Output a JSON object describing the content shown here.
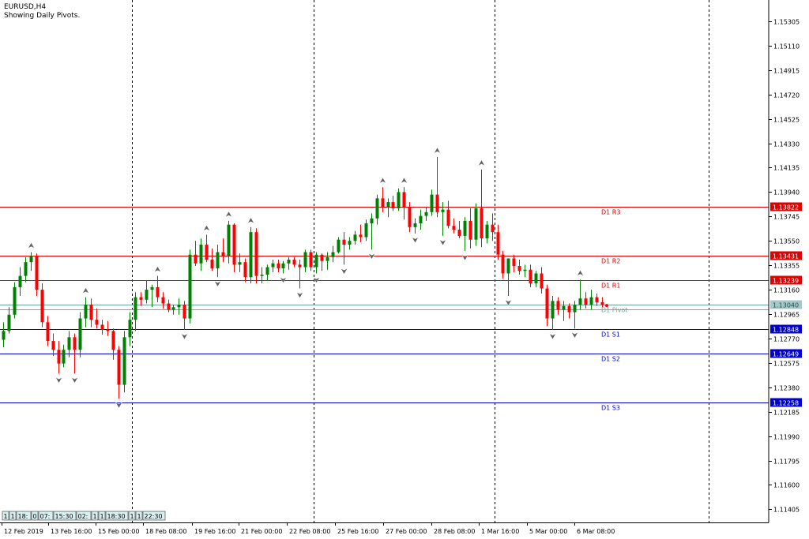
{
  "header": {
    "symbol": "EURUSD,H4",
    "subtitle": "Showing Daily Pivots."
  },
  "colors": {
    "bull": "#008000",
    "bear": "#ff0000",
    "resistance": "#e00000",
    "support": "#0000d0",
    "pivot": "#6fa3a3",
    "pivot_box": "#a8c8c8",
    "grid": "#000000",
    "arrow": "#606060"
  },
  "chart_data": {
    "type": "candlestick",
    "ylim": [
      1.113,
      1.1545
    ],
    "y_ticks": [
      "1.15305",
      "1.15110",
      "1.14915",
      "1.14720",
      "1.14525",
      "1.14330",
      "1.14135",
      "1.13940",
      "1.13745",
      "1.13550",
      "1.13355",
      "1.13160",
      "1.12965",
      "1.12770",
      "1.12575",
      "1.12380",
      "1.12185",
      "1.11990",
      "1.11795",
      "1.11600",
      "1.11405"
    ],
    "x_ticks": [
      "12 Feb 2019",
      "13 Feb 16:00",
      "15 Feb 00:00",
      "18 Feb 08:00",
      "19 Feb 16:00",
      "21 Feb 00:00",
      "22 Feb 08:00",
      "25 Feb 16:00",
      "27 Feb 00:00",
      "28 Feb 08:00",
      "1 Mar 16:00",
      "5 Mar 00:00",
      "6 Mar 08:00"
    ],
    "period_separators": [
      "15 Feb 2019",
      "22 Feb 2019",
      "1 Mar 2019",
      "8 Mar 2019"
    ],
    "pivots": [
      {
        "name": "D1 R3",
        "value": 1.13822,
        "label": "1.13822",
        "kind": "resistance"
      },
      {
        "name": "D1 R2",
        "value": 1.13431,
        "label": "1.13431",
        "kind": "resistance"
      },
      {
        "name": "D1 R1",
        "value": 1.13239,
        "label": "1.13239",
        "kind": "resistance"
      },
      {
        "name": "D1 Pivot",
        "value": 1.1304,
        "label": "1.13040",
        "kind": "pivot"
      },
      {
        "name": "D1 S1",
        "value": 1.12848,
        "label": "1.12848",
        "kind": "support"
      },
      {
        "name": "D1 S2",
        "value": 1.12649,
        "label": "1.12649",
        "kind": "support"
      },
      {
        "name": "D1 S3",
        "value": 1.12258,
        "label": "1.12258",
        "kind": "support"
      }
    ],
    "bottom_strip": [
      "1",
      "1",
      "18:",
      "0",
      "07:",
      "15:30",
      "02:",
      "1",
      "1",
      "18:30",
      "1",
      "1",
      "22:30"
    ],
    "candles": [
      [
        1.1276,
        1.129,
        1.127,
        1.1283
      ],
      [
        1.1283,
        1.1302,
        1.1281,
        1.1296
      ],
      [
        1.1296,
        1.1322,
        1.1293,
        1.1318
      ],
      [
        1.1318,
        1.1334,
        1.1311,
        1.1327
      ],
      [
        1.1327,
        1.1342,
        1.1322,
        1.1338
      ],
      [
        1.1338,
        1.1346,
        1.1331,
        1.1343
      ],
      [
        1.1343,
        1.1345,
        1.1311,
        1.1316
      ],
      [
        1.1316,
        1.1321,
        1.1286,
        1.129
      ],
      [
        1.129,
        1.1295,
        1.1271,
        1.1275
      ],
      [
        1.1275,
        1.1281,
        1.1263,
        1.1268
      ],
      [
        1.1268,
        1.1275,
        1.1249,
        1.1257
      ],
      [
        1.1257,
        1.1272,
        1.1254,
        1.1268
      ],
      [
        1.1268,
        1.1283,
        1.1262,
        1.1278
      ],
      [
        1.1278,
        1.1281,
        1.1249,
        1.1268
      ],
      [
        1.1268,
        1.1298,
        1.1262,
        1.1293
      ],
      [
        1.1293,
        1.131,
        1.1286,
        1.1304
      ],
      [
        1.1304,
        1.1309,
        1.1286,
        1.1292
      ],
      [
        1.1292,
        1.1301,
        1.1285,
        1.1288
      ],
      [
        1.1288,
        1.1292,
        1.128,
        1.1284
      ],
      [
        1.1284,
        1.1291,
        1.1279,
        1.1283
      ],
      [
        1.1283,
        1.1285,
        1.126,
        1.1268
      ],
      [
        1.1268,
        1.1271,
        1.1229,
        1.124
      ],
      [
        1.124,
        1.1283,
        1.1234,
        1.1278
      ],
      [
        1.1278,
        1.1298,
        1.1271,
        1.1292
      ],
      [
        1.1292,
        1.1314,
        1.1283,
        1.131
      ],
      [
        1.131,
        1.1314,
        1.1303,
        1.1308
      ],
      [
        1.1308,
        1.1323,
        1.1305,
        1.1316
      ],
      [
        1.1316,
        1.132,
        1.1302,
        1.1318
      ],
      [
        1.1318,
        1.1327,
        1.1306,
        1.131
      ],
      [
        1.131,
        1.1314,
        1.1301,
        1.1305
      ],
      [
        1.1305,
        1.1308,
        1.1298,
        1.13
      ],
      [
        1.13,
        1.1304,
        1.1296,
        1.1302
      ],
      [
        1.1302,
        1.1309,
        1.1296,
        1.1304
      ],
      [
        1.1304,
        1.1307,
        1.1284,
        1.1293
      ],
      [
        1.1293,
        1.1348,
        1.1289,
        1.1344
      ],
      [
        1.1344,
        1.1355,
        1.1335,
        1.1337
      ],
      [
        1.1337,
        1.1357,
        1.1331,
        1.1352
      ],
      [
        1.1352,
        1.136,
        1.1338,
        1.134
      ],
      [
        1.134,
        1.1349,
        1.1331,
        1.1333
      ],
      [
        1.1333,
        1.1352,
        1.1326,
        1.1346
      ],
      [
        1.1346,
        1.1357,
        1.1338,
        1.1343
      ],
      [
        1.1343,
        1.1371,
        1.1337,
        1.1368
      ],
      [
        1.1368,
        1.1369,
        1.133,
        1.1336
      ],
      [
        1.1336,
        1.1345,
        1.133,
        1.1338
      ],
      [
        1.1338,
        1.1341,
        1.1322,
        1.1326
      ],
      [
        1.1326,
        1.1366,
        1.1321,
        1.1362
      ],
      [
        1.1362,
        1.1365,
        1.1321,
        1.1327
      ],
      [
        1.1327,
        1.1334,
        1.1321,
        1.1328
      ],
      [
        1.1328,
        1.1336,
        1.1323,
        1.1334
      ],
      [
        1.1334,
        1.134,
        1.133,
        1.1337
      ],
      [
        1.1337,
        1.134,
        1.133,
        1.1333
      ],
      [
        1.1333,
        1.1339,
        1.1329,
        1.1337
      ],
      [
        1.1337,
        1.1342,
        1.1332,
        1.134
      ],
      [
        1.134,
        1.1342,
        1.1334,
        1.1336
      ],
      [
        1.1336,
        1.134,
        1.1317,
        1.1334
      ],
      [
        1.1334,
        1.1348,
        1.133,
        1.1346
      ],
      [
        1.1346,
        1.1348,
        1.1331,
        1.1334
      ],
      [
        1.1334,
        1.1346,
        1.1329,
        1.1344
      ],
      [
        1.1344,
        1.1345,
        1.1331,
        1.1339
      ],
      [
        1.1339,
        1.1346,
        1.1332,
        1.1342
      ],
      [
        1.1342,
        1.1351,
        1.1338,
        1.1346
      ],
      [
        1.1346,
        1.1358,
        1.1345,
        1.1356
      ],
      [
        1.1356,
        1.1362,
        1.1336,
        1.1352
      ],
      [
        1.1352,
        1.1358,
        1.1348,
        1.1355
      ],
      [
        1.1355,
        1.1363,
        1.1352,
        1.136
      ],
      [
        1.136,
        1.1368,
        1.1354,
        1.1358
      ],
      [
        1.1358,
        1.1372,
        1.1355,
        1.1369
      ],
      [
        1.1369,
        1.1377,
        1.1348,
        1.1373
      ],
      [
        1.1373,
        1.1392,
        1.1368,
        1.1389
      ],
      [
        1.1389,
        1.1398,
        1.1378,
        1.1382
      ],
      [
        1.1382,
        1.1389,
        1.1374,
        1.1386
      ],
      [
        1.1386,
        1.1391,
        1.1379,
        1.1381
      ],
      [
        1.1381,
        1.1397,
        1.1379,
        1.1394
      ],
      [
        1.1394,
        1.1398,
        1.1372,
        1.1382
      ],
      [
        1.1382,
        1.1386,
        1.1362,
        1.1366
      ],
      [
        1.1366,
        1.1373,
        1.1361,
        1.1369
      ],
      [
        1.1369,
        1.138,
        1.1364,
        1.1375
      ],
      [
        1.1375,
        1.1382,
        1.1371,
        1.1378
      ],
      [
        1.1378,
        1.1396,
        1.1375,
        1.1392
      ],
      [
        1.1392,
        1.1422,
        1.1374,
        1.1378
      ],
      [
        1.1378,
        1.1386,
        1.1359,
        1.138
      ],
      [
        1.138,
        1.1387,
        1.1365,
        1.1367
      ],
      [
        1.1367,
        1.1373,
        1.1361,
        1.1364
      ],
      [
        1.1364,
        1.1371,
        1.1357,
        1.1359
      ],
      [
        1.1359,
        1.1374,
        1.1347,
        1.1371
      ],
      [
        1.1371,
        1.1381,
        1.1349,
        1.1356
      ],
      [
        1.1356,
        1.1385,
        1.1351,
        1.1381
      ],
      [
        1.1381,
        1.1412,
        1.135,
        1.1357
      ],
      [
        1.1357,
        1.1371,
        1.1353,
        1.1368
      ],
      [
        1.1368,
        1.1377,
        1.1355,
        1.1362
      ],
      [
        1.1362,
        1.1368,
        1.134,
        1.1344
      ],
      [
        1.1344,
        1.1347,
        1.1325,
        1.1329
      ],
      [
        1.1329,
        1.1338,
        1.1311,
        1.1341
      ],
      [
        1.1341,
        1.1344,
        1.133,
        1.1335
      ],
      [
        1.1335,
        1.134,
        1.1328,
        1.1331
      ],
      [
        1.1331,
        1.1336,
        1.1326,
        1.1332
      ],
      [
        1.1332,
        1.1336,
        1.1318,
        1.1321
      ],
      [
        1.1321,
        1.1331,
        1.1318,
        1.1329
      ],
      [
        1.1329,
        1.1334,
        1.1313,
        1.1317
      ],
      [
        1.1317,
        1.132,
        1.1287,
        1.1293
      ],
      [
        1.1293,
        1.1311,
        1.1284,
        1.1307
      ],
      [
        1.1307,
        1.131,
        1.1296,
        1.13
      ],
      [
        1.13,
        1.1307,
        1.1291,
        1.1303
      ],
      [
        1.1303,
        1.1305,
        1.1293,
        1.1298
      ],
      [
        1.1298,
        1.1307,
        1.1285,
        1.1304
      ],
      [
        1.1304,
        1.1324,
        1.13,
        1.1309
      ],
      [
        1.1309,
        1.1314,
        1.1301,
        1.1304
      ],
      [
        1.1304,
        1.1316,
        1.13,
        1.131
      ],
      [
        1.131,
        1.1313,
        1.1303,
        1.1306
      ],
      [
        1.1306,
        1.131,
        1.1302,
        1.1304
      ]
    ]
  }
}
